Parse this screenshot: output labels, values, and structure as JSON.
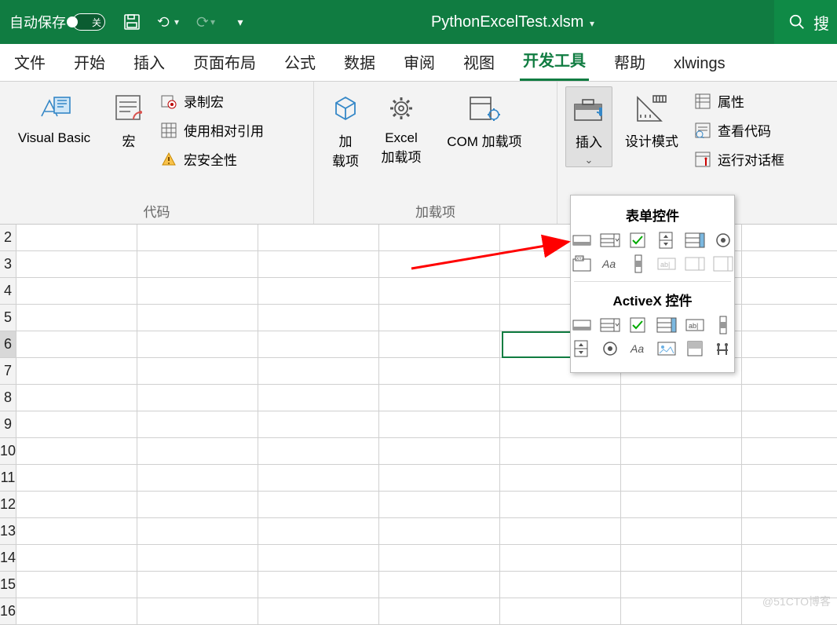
{
  "titlebar": {
    "autosave_label": "自动保存",
    "autosave_state": "关",
    "filename": "PythonExcelTest.xlsm",
    "search_placeholder": "搜"
  },
  "tabs": {
    "file": "文件",
    "home": "开始",
    "insert": "插入",
    "layout": "页面布局",
    "formulas": "公式",
    "data": "数据",
    "review": "审阅",
    "view": "视图",
    "developer": "开发工具",
    "help": "帮助",
    "xlwings": "xlwings"
  },
  "ribbon": {
    "code": {
      "visual_basic": "Visual Basic",
      "macros": "宏",
      "record_macro": "录制宏",
      "use_relative": "使用相对引用",
      "macro_security": "宏安全性",
      "group_label": "代码"
    },
    "addins": {
      "addins": "加\n载项",
      "excel_addins": "Excel\n加载项",
      "com_addins": "COM 加载项",
      "group_label": "加载项"
    },
    "controls": {
      "insert": "插入",
      "design_mode": "设计模式",
      "properties": "属性",
      "view_code": "查看代码",
      "run_dialog": "运行对话框"
    }
  },
  "insert_panel": {
    "form_title": "表单控件",
    "activex_title": "ActiveX 控件",
    "form_controls": [
      {
        "n": "button",
        "d": false
      },
      {
        "n": "combo",
        "d": false
      },
      {
        "n": "checkbox",
        "d": false
      },
      {
        "n": "spinner",
        "d": false
      },
      {
        "n": "listbox",
        "d": false
      },
      {
        "n": "option",
        "d": false
      },
      {
        "n": "groupbox",
        "d": false
      },
      {
        "n": "label",
        "d": false
      },
      {
        "n": "scrollbar",
        "d": false
      },
      {
        "n": "textfield",
        "d": true
      },
      {
        "n": "combo2",
        "d": true
      },
      {
        "n": "listbox2",
        "d": true
      }
    ],
    "activex_controls": [
      {
        "n": "button",
        "d": false
      },
      {
        "n": "combo",
        "d": false
      },
      {
        "n": "checkbox",
        "d": false
      },
      {
        "n": "listbox",
        "d": false
      },
      {
        "n": "textbox",
        "d": false
      },
      {
        "n": "scrollbar",
        "d": false
      },
      {
        "n": "spinner",
        "d": false
      },
      {
        "n": "option",
        "d": false
      },
      {
        "n": "label",
        "d": false
      },
      {
        "n": "image",
        "d": false
      },
      {
        "n": "toggle",
        "d": false
      },
      {
        "n": "more",
        "d": false
      }
    ]
  },
  "rows": [
    "2",
    "3",
    "4",
    "5",
    "6",
    "7",
    "8",
    "9",
    "10",
    "11",
    "12",
    "13",
    "14",
    "15",
    "16"
  ],
  "selected_row": "6",
  "watermark": "@51CTO博客"
}
